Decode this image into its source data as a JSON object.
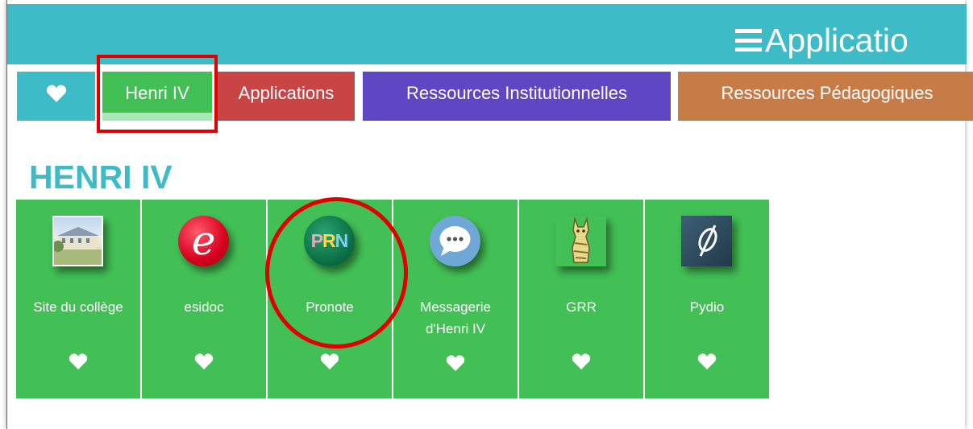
{
  "header": {
    "menu_title": "Applicatio"
  },
  "tabs": [
    {
      "label": "",
      "icon": "heart-icon",
      "color": "#3dbcc7"
    },
    {
      "label": "Henri IV",
      "color": "#42c055"
    },
    {
      "label": "Applications",
      "color": "#c94545"
    },
    {
      "label": "Ressources Institutionnelles",
      "color": "#5d47c2"
    },
    {
      "label": "Ressources Pédagogiques",
      "color": "#c77c48"
    }
  ],
  "section": {
    "title": "HENRI IV"
  },
  "apps": [
    {
      "name": "Site du collège",
      "icon": "school-photo-icon",
      "favorite_icon": "heart-icon"
    },
    {
      "name": "esidoc",
      "icon": "esidoc-logo-icon",
      "icon_text": "e",
      "favorite_icon": "heart-icon"
    },
    {
      "name": "Pronote",
      "icon": "pronote-logo-icon",
      "icon_text": "PRN",
      "favorite_icon": "heart-icon"
    },
    {
      "name": "Messagerie d'Henri IV",
      "name_line1": "Messagerie",
      "name_line2": "d'Henri IV",
      "icon": "chat-bubble-icon",
      "favorite_icon": "heart-icon"
    },
    {
      "name": "GRR",
      "icon": "cat-drawing-icon",
      "favorite_icon": "heart-icon"
    },
    {
      "name": "Pydio",
      "icon": "pydio-logo-icon",
      "favorite_icon": "heart-icon"
    }
  ],
  "annotations": {
    "highlight_color": "#e00000"
  },
  "colors": {
    "topbar": "#3dbcc7",
    "tile": "#42c055",
    "title": "#3dbcc7"
  }
}
